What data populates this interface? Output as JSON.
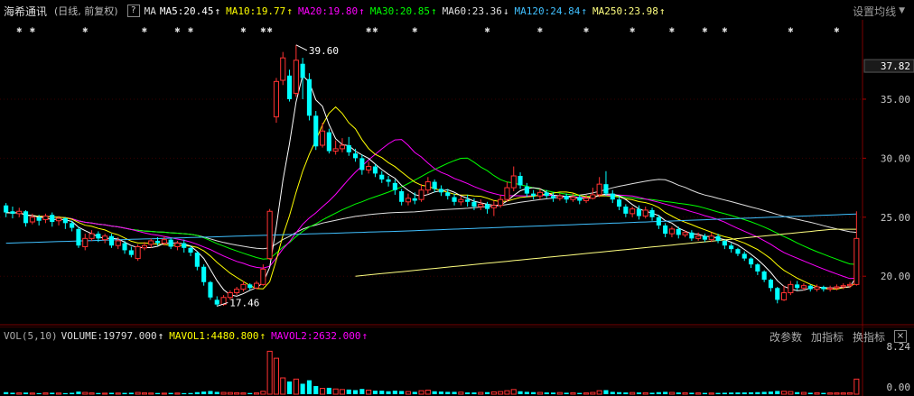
{
  "header": {
    "stock_name": "海希通讯",
    "period": "(日线, 前复权)",
    "help": "?",
    "ma_label": "MA",
    "indicators": [
      {
        "text": "MA5:20.45",
        "color": "#ffffff"
      },
      {
        "text": "MA10:19.77",
        "color": "#ffff00"
      },
      {
        "text": "MA20:19.80",
        "color": "#ff00ff"
      },
      {
        "text": "MA30:20.85",
        "color": "#00ff00"
      },
      {
        "text": "MA60:23.36",
        "color": "#e0e0e0"
      },
      {
        "text": "MA120:24.84",
        "color": "#40c0ff"
      },
      {
        "text": "MA250:23.98",
        "color": "#ffff80"
      }
    ],
    "settings_menu": "设置均线"
  },
  "volume_header": {
    "label": "VOL(5,10)",
    "volume": "VOLUME:19797.000",
    "mavol1": "MAVOL1:4480.800",
    "mavol2": "MAVOL2:2632.000",
    "menu": [
      "改参数",
      "加指标",
      "换指标"
    ],
    "close": "×"
  },
  "chart_data": {
    "type": "candlestick",
    "price_axis": {
      "ticks": [
        20.0,
        25.0,
        30.0,
        35.0
      ],
      "current_price": "37.82",
      "range": [
        16.5,
        40.5
      ]
    },
    "volume_axis": {
      "ticks": [
        "8.24",
        "0.00"
      ],
      "range": [
        0,
        8.24
      ]
    },
    "annotations": {
      "high": "39.60",
      "low": "17.46"
    },
    "colors": {
      "up": "#ff3232",
      "down": "#00ffff",
      "ma5": "#ffffff",
      "ma10": "#ffff00",
      "ma20": "#ff00ff",
      "ma30": "#00ff00",
      "ma60": "#e0e0e0",
      "ma120": "#40c0ff",
      "ma250": "#ffff80"
    },
    "candles": [
      [
        26.0,
        25.4,
        26.2,
        25.0
      ],
      [
        25.5,
        25.3,
        25.9,
        24.9
      ],
      [
        25.3,
        25.5,
        25.8,
        25.0
      ],
      [
        25.5,
        24.5,
        25.6,
        24.2
      ],
      [
        24.6,
        25.0,
        25.3,
        24.4
      ],
      [
        25.0,
        24.7,
        25.2,
        24.3
      ],
      [
        24.8,
        25.1,
        25.3,
        24.5
      ],
      [
        25.2,
        24.6,
        25.4,
        24.2
      ],
      [
        24.7,
        24.9,
        25.1,
        24.3
      ],
      [
        24.9,
        24.5,
        25.0,
        24.0
      ],
      [
        24.5,
        24.1,
        24.7,
        23.8
      ],
      [
        24.0,
        22.6,
        24.2,
        22.4
      ],
      [
        22.5,
        23.2,
        23.6,
        22.2
      ],
      [
        23.2,
        23.6,
        23.9,
        23.0
      ],
      [
        23.6,
        23.2,
        23.8,
        22.9
      ],
      [
        23.1,
        23.4,
        23.6,
        22.8
      ],
      [
        23.4,
        22.6,
        23.6,
        22.4
      ],
      [
        22.6,
        23.0,
        23.3,
        22.3
      ],
      [
        22.8,
        22.2,
        23.0,
        21.9
      ],
      [
        22.2,
        21.8,
        22.5,
        21.6
      ],
      [
        21.5,
        22.5,
        22.7,
        21.3
      ],
      [
        22.4,
        22.6,
        22.9,
        22.2
      ],
      [
        22.7,
        23.0,
        23.2,
        22.4
      ],
      [
        23.0,
        22.8,
        23.3,
        22.6
      ],
      [
        22.8,
        23.1,
        23.4,
        22.6
      ],
      [
        23.1,
        22.5,
        23.2,
        22.3
      ],
      [
        22.5,
        22.8,
        23.0,
        22.2
      ],
      [
        22.8,
        22.4,
        23.1,
        22.0
      ],
      [
        22.4,
        22.0,
        22.6,
        21.7
      ],
      [
        22.0,
        20.8,
        22.1,
        20.5
      ],
      [
        20.8,
        19.5,
        21.0,
        19.2
      ],
      [
        19.5,
        18.2,
        19.6,
        18.0
      ],
      [
        18.0,
        17.6,
        18.3,
        17.46
      ],
      [
        17.6,
        18.2,
        18.4,
        17.5
      ],
      [
        18.2,
        18.6,
        18.8,
        18.0
      ],
      [
        18.6,
        18.9,
        19.1,
        18.4
      ],
      [
        18.9,
        19.3,
        19.6,
        18.7
      ],
      [
        19.3,
        19.0,
        19.4,
        18.8
      ],
      [
        19.0,
        19.4,
        19.6,
        18.9
      ],
      [
        19.3,
        20.6,
        21.0,
        19.2
      ],
      [
        21.5,
        25.5,
        25.7,
        21.4
      ],
      [
        33.5,
        36.5,
        36.8,
        33.0
      ],
      [
        36.6,
        38.5,
        39.0,
        36.2
      ],
      [
        37.0,
        35.0,
        37.5,
        34.8
      ],
      [
        35.5,
        38.3,
        39.6,
        35.2
      ],
      [
        38.0,
        36.8,
        38.5,
        35.0
      ],
      [
        36.7,
        33.6,
        37.2,
        33.2
      ],
      [
        33.6,
        31.0,
        34.0,
        30.7
      ],
      [
        31.1,
        32.3,
        33.0,
        30.9
      ],
      [
        32.2,
        30.6,
        32.5,
        30.4
      ],
      [
        30.6,
        30.8,
        31.5,
        30.3
      ],
      [
        30.8,
        31.1,
        31.7,
        30.5
      ],
      [
        31.1,
        30.5,
        31.8,
        30.2
      ],
      [
        30.4,
        30.0,
        30.8,
        29.7
      ],
      [
        30.0,
        29.0,
        30.3,
        28.6
      ],
      [
        29.0,
        29.3,
        29.7,
        28.7
      ],
      [
        29.3,
        28.7,
        29.5,
        28.4
      ],
      [
        28.6,
        28.2,
        28.9,
        27.9
      ],
      [
        28.2,
        28.0,
        28.5,
        27.6
      ],
      [
        27.9,
        27.3,
        28.2,
        26.9
      ],
      [
        27.2,
        26.3,
        27.4,
        26.0
      ],
      [
        26.3,
        26.6,
        27.0,
        26.0
      ],
      [
        26.6,
        26.4,
        27.1,
        26.1
      ],
      [
        26.5,
        27.3,
        27.8,
        26.3
      ],
      [
        27.3,
        28.0,
        28.4,
        27.0
      ],
      [
        28.0,
        27.4,
        28.2,
        27.1
      ],
      [
        27.4,
        27.1,
        27.7,
        26.8
      ],
      [
        27.1,
        26.8,
        27.4,
        26.5
      ],
      [
        26.7,
        26.3,
        27.0,
        26.0
      ],
      [
        26.3,
        26.5,
        26.8,
        26.0
      ],
      [
        26.5,
        26.3,
        26.9,
        25.9
      ],
      [
        26.3,
        25.9,
        26.6,
        25.6
      ],
      [
        25.9,
        26.1,
        26.5,
        25.6
      ],
      [
        26.1,
        25.7,
        26.3,
        25.3
      ],
      [
        25.8,
        26.0,
        26.4,
        25.1
      ],
      [
        26.0,
        26.5,
        26.9,
        25.8
      ],
      [
        26.5,
        27.5,
        28.0,
        26.3
      ],
      [
        27.5,
        28.5,
        29.3,
        27.2
      ],
      [
        28.5,
        27.7,
        28.8,
        27.4
      ],
      [
        27.6,
        27.0,
        27.9,
        26.7
      ],
      [
        27.0,
        26.8,
        27.3,
        26.5
      ],
      [
        26.8,
        27.1,
        27.4,
        26.5
      ],
      [
        27.1,
        26.8,
        27.3,
        26.6
      ],
      [
        26.8,
        26.6,
        27.1,
        26.3
      ],
      [
        26.6,
        26.8,
        27.0,
        26.4
      ],
      [
        26.8,
        26.5,
        27.0,
        26.2
      ],
      [
        26.5,
        26.7,
        27.0,
        26.3
      ],
      [
        26.7,
        26.4,
        26.9,
        26.1
      ],
      [
        26.4,
        26.6,
        26.9,
        26.2
      ],
      [
        26.6,
        26.9,
        27.5,
        26.5
      ],
      [
        26.9,
        27.8,
        28.4,
        26.7
      ],
      [
        27.8,
        27.0,
        28.9,
        26.8
      ],
      [
        27.0,
        26.5,
        27.3,
        26.2
      ],
      [
        26.5,
        25.9,
        26.8,
        25.6
      ],
      [
        25.9,
        25.3,
        26.1,
        25.0
      ],
      [
        25.3,
        25.7,
        25.9,
        25.0
      ],
      [
        25.7,
        25.1,
        26.0,
        24.8
      ],
      [
        25.1,
        25.6,
        25.9,
        24.9
      ],
      [
        25.6,
        25.0,
        25.8,
        24.7
      ],
      [
        25.0,
        24.3,
        25.2,
        24.0
      ],
      [
        24.3,
        23.6,
        24.5,
        23.3
      ],
      [
        23.6,
        24.0,
        24.2,
        23.3
      ],
      [
        24.0,
        23.5,
        24.2,
        23.2
      ],
      [
        23.5,
        23.7,
        23.9,
        23.3
      ],
      [
        23.7,
        23.2,
        23.9,
        23.0
      ],
      [
        23.2,
        23.4,
        23.7,
        23.0
      ],
      [
        23.4,
        23.1,
        23.6,
        22.9
      ],
      [
        23.1,
        23.4,
        23.7,
        22.9
      ],
      [
        23.4,
        23.0,
        23.6,
        22.8
      ],
      [
        23.0,
        22.6,
        23.1,
        22.3
      ],
      [
        22.6,
        22.3,
        22.8,
        22.0
      ],
      [
        22.3,
        21.9,
        22.4,
        21.7
      ],
      [
        21.9,
        21.5,
        22.1,
        21.3
      ],
      [
        21.5,
        21.0,
        21.6,
        20.7
      ],
      [
        21.0,
        20.4,
        21.1,
        20.1
      ],
      [
        20.4,
        19.7,
        20.5,
        19.5
      ],
      [
        19.7,
        19.0,
        19.8,
        18.7
      ],
      [
        19.0,
        18.0,
        19.1,
        17.7
      ],
      [
        18.0,
        18.6,
        19.2,
        17.9
      ],
      [
        18.6,
        19.3,
        19.6,
        18.4
      ],
      [
        19.3,
        19.0,
        19.6,
        18.8
      ],
      [
        19.0,
        19.2,
        19.4,
        18.8
      ],
      [
        19.2,
        18.9,
        19.3,
        18.7
      ],
      [
        18.9,
        19.1,
        19.3,
        18.7
      ],
      [
        19.1,
        18.9,
        19.2,
        18.7
      ],
      [
        18.9,
        19.0,
        19.2,
        18.7
      ],
      [
        19.0,
        19.1,
        19.3,
        18.8
      ],
      [
        19.1,
        19.2,
        19.4,
        18.9
      ],
      [
        19.2,
        19.3,
        19.5,
        19.0
      ],
      [
        19.3,
        23.2,
        25.5,
        19.2
      ]
    ],
    "volume": [
      0.35,
      0.25,
      0.22,
      0.28,
      0.2,
      0.18,
      0.22,
      0.25,
      0.2,
      0.18,
      0.24,
      0.45,
      0.3,
      0.22,
      0.2,
      0.18,
      0.24,
      0.2,
      0.22,
      0.25,
      0.3,
      0.22,
      0.2,
      0.2,
      0.18,
      0.22,
      0.2,
      0.18,
      0.2,
      0.35,
      0.45,
      0.55,
      0.4,
      0.3,
      0.28,
      0.25,
      0.22,
      0.2,
      0.22,
      0.5,
      7.4,
      6.2,
      2.8,
      2.2,
      2.6,
      1.8,
      2.4,
      1.4,
      1.0,
      1.1,
      0.9,
      0.8,
      0.8,
      0.7,
      0.9,
      0.7,
      0.6,
      0.6,
      0.5,
      0.6,
      0.55,
      0.45,
      0.4,
      0.6,
      0.7,
      0.5,
      0.45,
      0.4,
      0.4,
      0.35,
      0.3,
      0.3,
      0.3,
      0.35,
      0.4,
      0.45,
      0.6,
      0.8,
      0.5,
      0.4,
      0.35,
      0.3,
      0.3,
      0.28,
      0.28,
      0.25,
      0.25,
      0.22,
      0.22,
      0.3,
      0.6,
      0.7,
      0.4,
      0.35,
      0.3,
      0.28,
      0.3,
      0.25,
      0.25,
      0.35,
      0.4,
      0.3,
      0.3,
      0.25,
      0.25,
      0.22,
      0.22,
      0.2,
      0.22,
      0.25,
      0.28,
      0.3,
      0.3,
      0.32,
      0.35,
      0.4,
      0.45,
      0.55,
      0.5,
      0.45,
      0.35,
      0.3,
      0.25,
      0.25,
      0.22,
      0.22,
      0.22,
      0.22,
      0.25,
      2.6
    ]
  }
}
